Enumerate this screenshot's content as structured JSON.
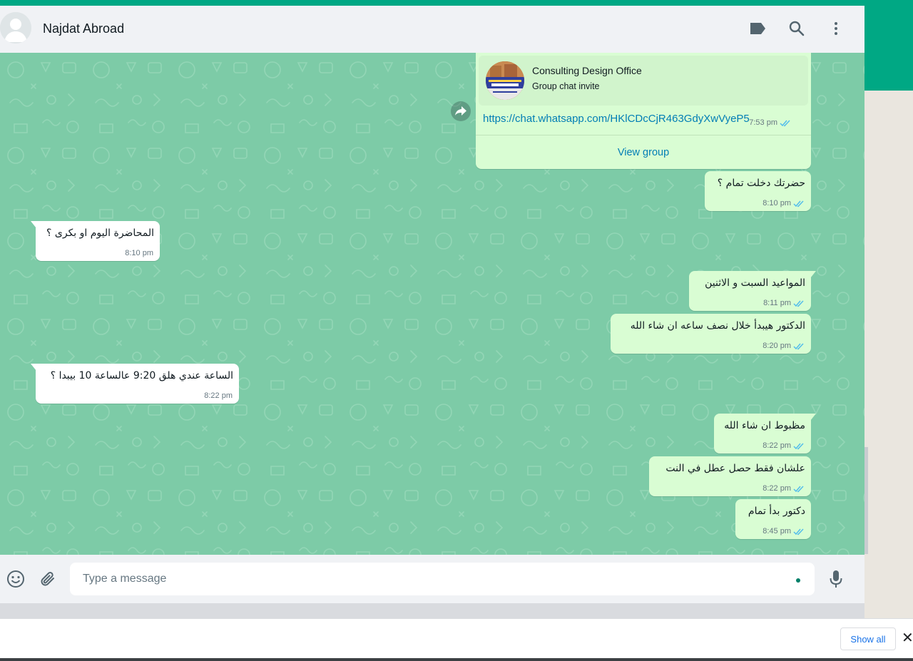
{
  "header": {
    "contact_name": "Najdat Abroad"
  },
  "icons": {
    "avatar": "default-avatar-icon",
    "label": "label-tag-icon",
    "search": "search-icon",
    "menu": "more-vertical-icon",
    "forward": "forward-icon",
    "emoji": "emoji-icon",
    "attach": "paperclip-icon",
    "mic": "microphone-icon",
    "read": "double-check-icon"
  },
  "invite": {
    "group_name": "Consulting Design Office",
    "subtitle": "Group chat invite",
    "link": "https://chat.whatsapp.com/HKlCDcCjR463GdyXwVyeP5",
    "time": "7:53 pm",
    "action": "View group"
  },
  "messages": [
    {
      "dir": "out",
      "text": "حضرتك دخلت تمام ؟",
      "time": "8:10 pm"
    },
    {
      "dir": "in",
      "text": "المحاضرة اليوم او بكرى ؟",
      "time": "8:10 pm"
    },
    {
      "dir": "out",
      "text": "المواعيد السبت و الاثنين",
      "time": "8:11 pm"
    },
    {
      "dir": "out",
      "text": "الدكتور هيبدأ خلال نصف ساعه ان شاء الله",
      "time": "8:20 pm"
    },
    {
      "dir": "in",
      "text": "الساعة عندي هلق 9:20 عالساعة 10 بيبدا ؟",
      "time": "8:22 pm"
    },
    {
      "dir": "out",
      "text": "مظبوط ان شاء الله",
      "time": "8:22 pm"
    },
    {
      "dir": "out",
      "text": "علشان فقط حصل عطل في النت",
      "time": "8:22 pm"
    },
    {
      "dir": "out",
      "text": "دكتور بدأ تمام",
      "time": "8:45 pm"
    }
  ],
  "composer": {
    "placeholder": "Type a message"
  },
  "downloads": {
    "show_all": "Show all",
    "close": "✕"
  },
  "colors": {
    "accent": "#00a884",
    "chat_bg": "#7dcba7",
    "outgoing": "#d9fdd3",
    "incoming": "#ffffff",
    "link": "#027eb5",
    "read_tick": "#53bdeb"
  }
}
